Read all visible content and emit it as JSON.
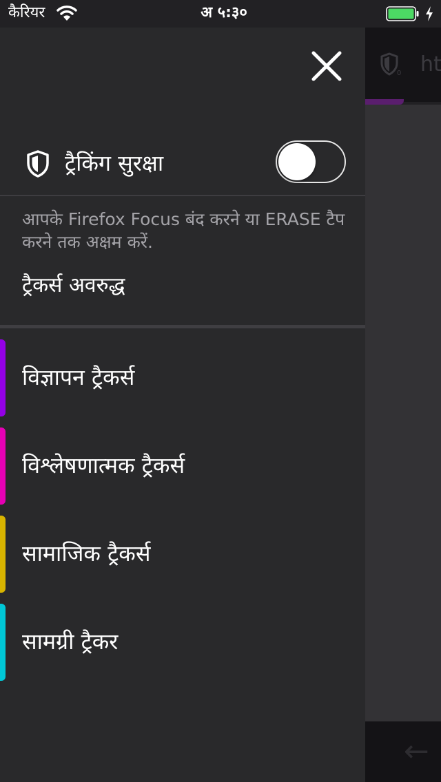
{
  "status_bar": {
    "carrier": "कैरियर",
    "time": "अ ५:३०",
    "battery_color": "#4cd964"
  },
  "background": {
    "url_text": "htt",
    "progress_color": "#5a1e6e"
  },
  "panel": {
    "close_icon": "close-icon",
    "tracking_protection": {
      "label": "ट्रैकिंग सुरक्षा",
      "icon": "shield-icon",
      "enabled": false
    },
    "description": "आपके Firefox Focus बंद करने या ERASE टैप करने तक अक्षम करें.",
    "blocked_label": "ट्रैकर्स अवरुद्ध",
    "trackers": [
      {
        "label": "विज्ञापन ट्रैकर्स",
        "color": "#9400e6"
      },
      {
        "label": "विश्लेषणात्मक ट्रैकर्स",
        "color": "#e600b4"
      },
      {
        "label": "सामाजिक ट्रैकर्स",
        "color": "#d8b400"
      },
      {
        "label": "सामग्री ट्रैकर",
        "color": "#00c8d7"
      }
    ]
  }
}
